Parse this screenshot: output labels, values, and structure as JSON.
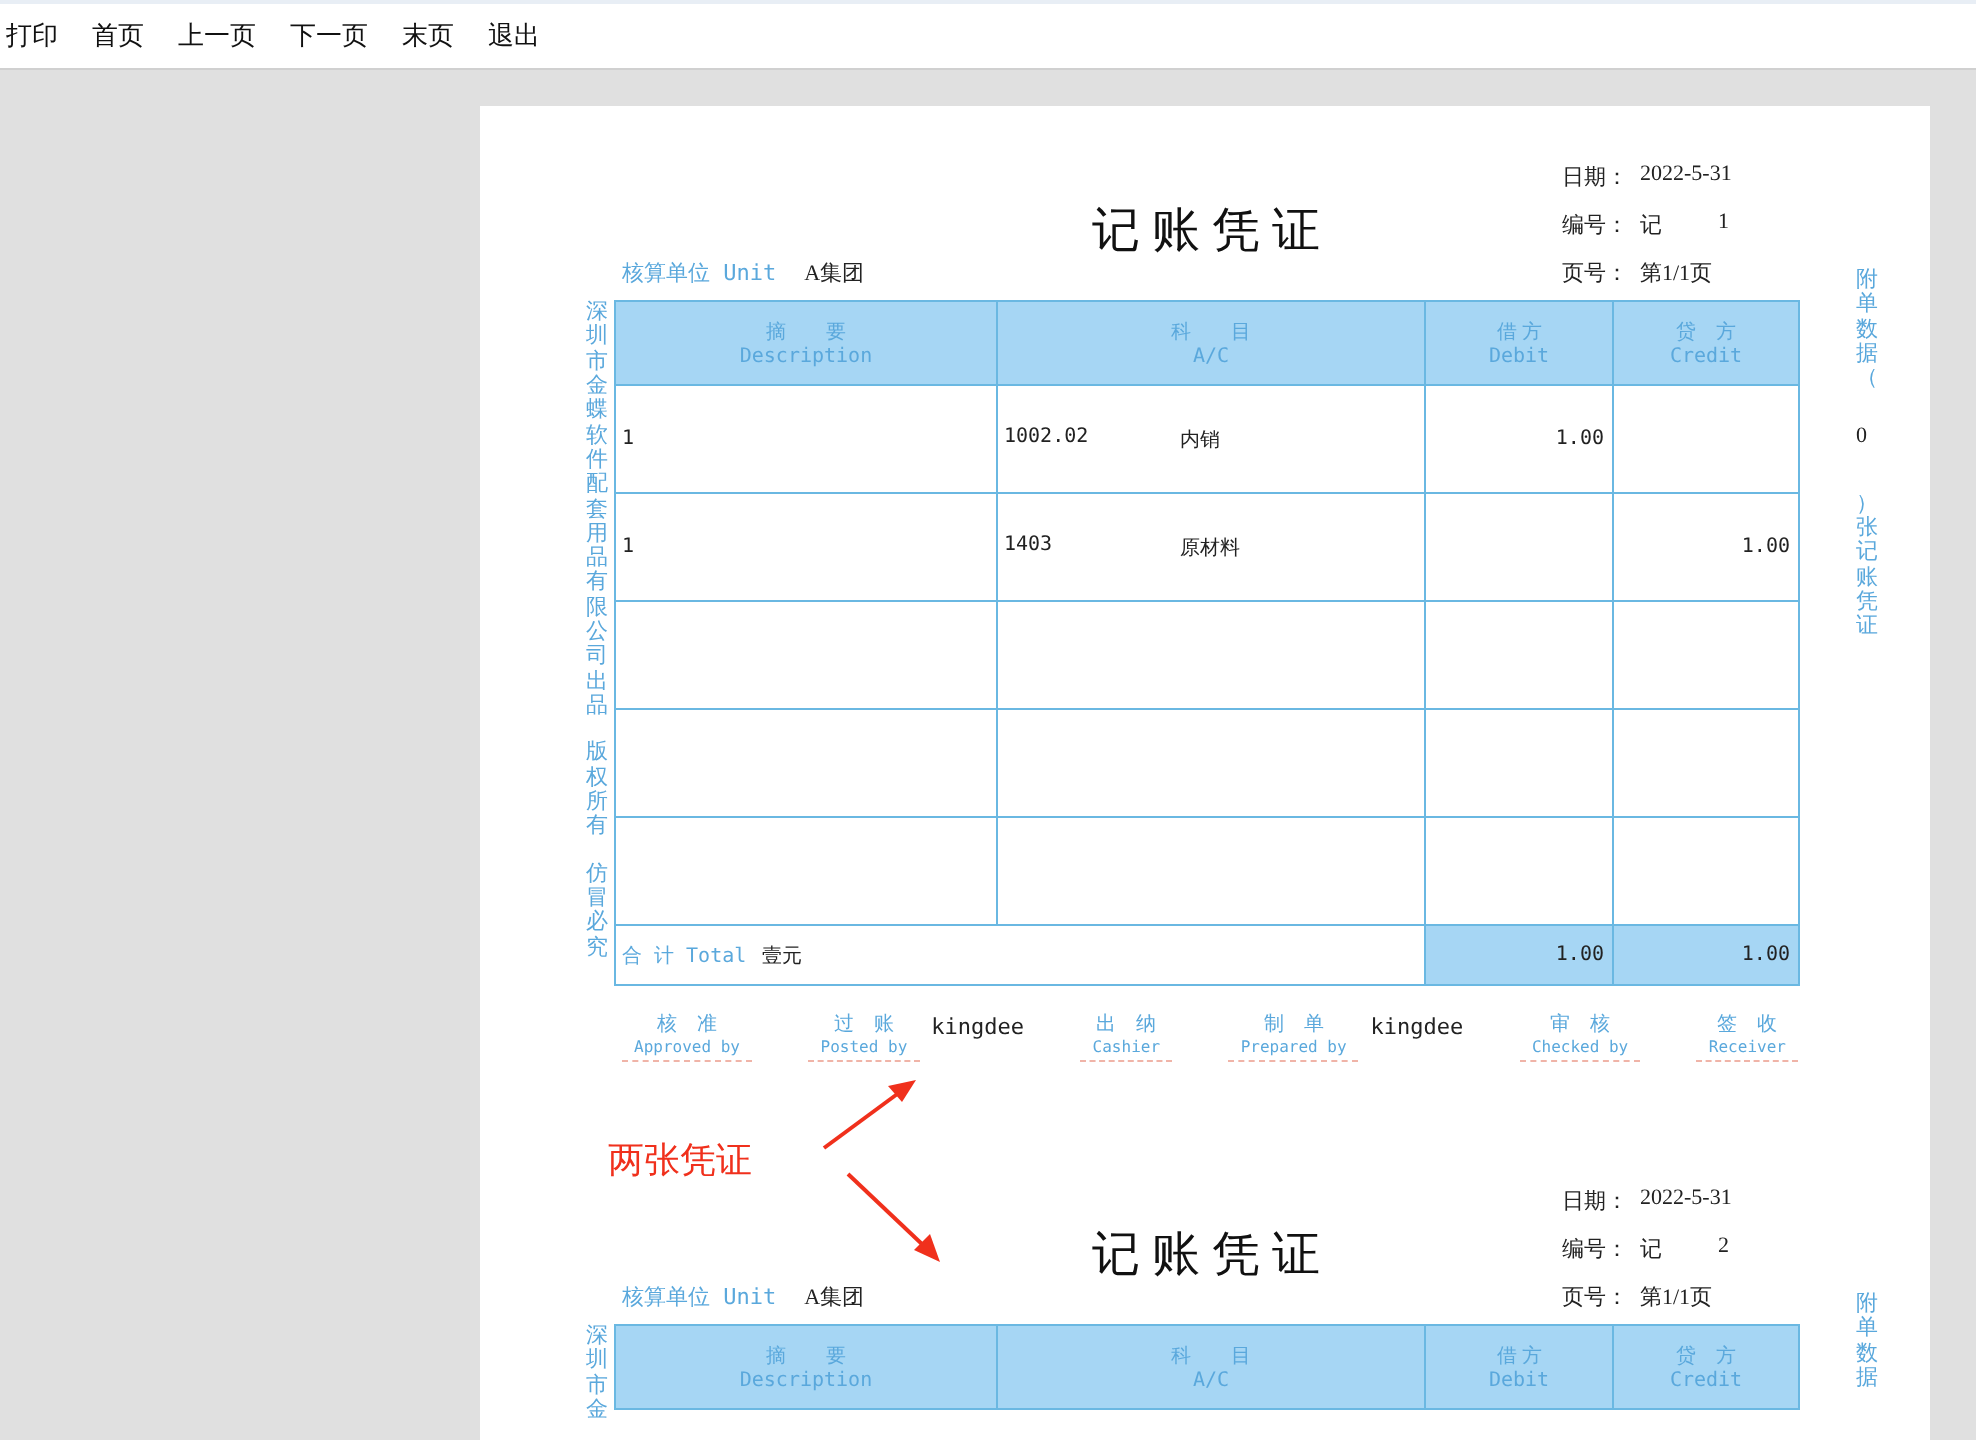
{
  "toolbar": {
    "items": [
      "打印",
      "首页",
      "上一页",
      "下一页",
      "末页",
      "退出"
    ]
  },
  "vouchers": [
    {
      "title": "记 账 凭 证",
      "unit_label": "核算单位 Unit",
      "unit_value": "A集团",
      "info": [
        {
          "label": "日期：",
          "value": "2022-5-31"
        },
        {
          "label": "编号：",
          "value": "记",
          "number": "1"
        },
        {
          "label": "页号：",
          "value": "第1/1页"
        }
      ],
      "left_note": [
        "深圳市金蝶软件配套用品有限公司出品",
        "版权所有",
        "仿冒必究"
      ],
      "right_note": {
        "before": "附单数据（",
        "count": "0",
        "after": "）张记账凭证"
      },
      "columns": [
        {
          "cn": "摘　　要",
          "en": "Description"
        },
        {
          "cn": "科　　目",
          "en": "A/C"
        },
        {
          "cn": "借 方",
          "en": "Debit"
        },
        {
          "cn": "贷　方",
          "en": "Credit"
        }
      ],
      "rows": [
        {
          "description": "1",
          "account_code": "1002.02",
          "account_name": "内销",
          "debit": "1.00"
        },
        {
          "description": "1",
          "account_code": "1403",
          "account_name": "原材料",
          "credit": "1.00"
        }
      ],
      "total": {
        "label": "合 计 Total",
        "amount_words": "壹元",
        "debit": "1.00",
        "credit": "1.00"
      },
      "signatures": [
        {
          "cn": "核　准",
          "en": "Approved by"
        },
        {
          "cn": "过　账",
          "en": "Posted by",
          "value": "kingdee"
        },
        {
          "cn": "出　纳",
          "en": "Cashier"
        },
        {
          "cn": "制　单",
          "en": "Prepared by",
          "value": "kingdee"
        },
        {
          "cn": "审　核",
          "en": "Checked by"
        },
        {
          "cn": "签　收",
          "en": "Receiver"
        }
      ]
    },
    {
      "title": "记 账 凭 证",
      "unit_label": "核算单位 Unit",
      "unit_value": "A集团",
      "info": [
        {
          "label": "日期：",
          "value": "2022-5-31"
        },
        {
          "label": "编号：",
          "value": "记",
          "number": "2"
        },
        {
          "label": "页号：",
          "value": "第1/1页"
        }
      ],
      "left_note": [
        "深圳市金"
      ],
      "right_note": {
        "before": "附单数据"
      },
      "columns": [
        {
          "cn": "摘　　要",
          "en": "Description"
        },
        {
          "cn": "科　　目",
          "en": "A/C"
        },
        {
          "cn": "借 方",
          "en": "Debit"
        },
        {
          "cn": "贷　方",
          "en": "Credit"
        }
      ]
    }
  ],
  "annotation": {
    "text": "两张凭证"
  }
}
